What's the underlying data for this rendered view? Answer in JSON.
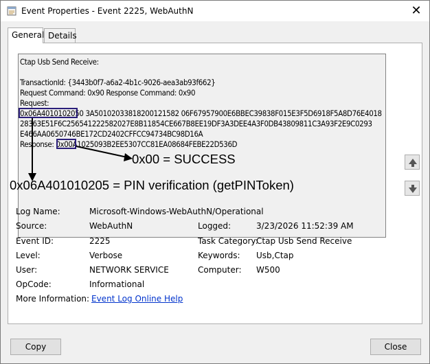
{
  "window": {
    "title": "Event Properties - Event 2225, WebAuthN",
    "close_glyph": "✕",
    "icon": "event-viewer-icon"
  },
  "tabs": [
    {
      "label": "General",
      "active": true
    },
    {
      "label": "Details",
      "active": false
    }
  ],
  "description": {
    "lines": [
      "Ctap Usb Send Receive:",
      "",
      "TransactionId: {3443b0f7-a6a2-4b1c-9026-aea3ab93f662}",
      "Request Command: 0x90 Response Command: 0x90",
      "Request:",
      "0x06A4010102050 3A50102033818200121582 06F67957900E6BBEC39838F015E3F5D6918F5A8D76E4018",
      "28363E51F6C256541222582027E8B11854CE667B8EE19DF3A3DEE4A3F0DB43809811C3A93F2E9C0293",
      "E466AA0650746BE172CD2402CFFCC94734BC98D16A",
      "Response: 0x00A1025093B2EE5307CC81EA08684FEBE22D536D"
    ]
  },
  "annotations": {
    "success": "0x00 = SUCCESS",
    "pin": "0x06A401010205 = PIN verification (getPINToken)",
    "color": "#2a1e7a"
  },
  "fields": {
    "log_name_label": "Log Name:",
    "log_name_value": "Microsoft-Windows-WebAuthN/Operational",
    "source_label": "Source:",
    "source_value": "WebAuthN",
    "logged_label": "Logged:",
    "logged_value": "3/23/2026 11:52:39 AM",
    "event_id_label": "Event ID:",
    "event_id_value": "2225",
    "task_category_label": "Task Category:",
    "task_category_value": "Ctap Usb Send Receive",
    "level_label": "Level:",
    "level_value": "Verbose",
    "keywords_label": "Keywords:",
    "keywords_value": "Usb,Ctap",
    "user_label": "User:",
    "user_value": "NETWORK SERVICE",
    "computer_label": "Computer:",
    "computer_value": "W500",
    "opcode_label": "OpCode:",
    "opcode_value": "Informational",
    "more_info_label": "More Information:",
    "more_info_link": "Event Log Online Help"
  },
  "buttons": {
    "copy": "Copy",
    "close": "Close",
    "scroll_up_icon": "up-arrow-icon",
    "scroll_down_icon": "down-arrow-icon"
  }
}
